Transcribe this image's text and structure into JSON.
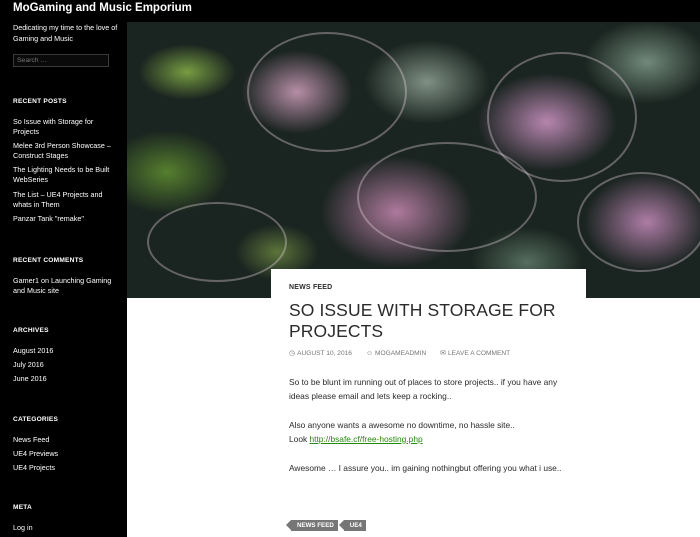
{
  "site": {
    "title": "MoGaming and Music Emporium",
    "description": "Dedicating my time to the love of Gaming and Music"
  },
  "search": {
    "placeholder": "Search …"
  },
  "widgets": {
    "recent_posts": {
      "title": "RECENT POSTS",
      "items": [
        "So Issue with Storage for Projects",
        "Melee 3rd Person Showcase – Construct Stages",
        "The Lighting Needs to be Built WebSeries",
        "The List – UE4 Projects and whats in Them",
        "Panzar Tank \"remake\""
      ]
    },
    "recent_comments": {
      "title": "RECENT COMMENTS",
      "author": "Gamer1",
      "on": " on ",
      "post": "Launching Gaming and Music site"
    },
    "archives": {
      "title": "ARCHIVES",
      "items": [
        "August 2016",
        "July 2016",
        "June 2016"
      ]
    },
    "categories": {
      "title": "CATEGORIES",
      "items": [
        "News Feed",
        "UE4 Previews",
        "UE4 Projects"
      ]
    },
    "meta": {
      "title": "META",
      "items": [
        "Log in"
      ]
    }
  },
  "post": {
    "category": "NEWS FEED",
    "title": "SO ISSUE WITH STORAGE FOR PROJECTS",
    "date": "AUGUST 10, 2016",
    "author": "MOGAMEADMIN",
    "comments": "LEAVE A COMMENT",
    "icons": {
      "date": "clock-icon",
      "author": "user-icon",
      "comments": "comment-icon"
    },
    "paragraph1": "So to be blunt im running out of places to store projects.. if you have any ideas please email and lets keep a rocking..",
    "paragraph2_line1": "Also anyone wants a awesome no downtime, no hassle site..",
    "paragraph2_prefix": "Look ",
    "paragraph2_link": "http://bsafe.cf/free-hosting.php",
    "paragraph3": "Awesome … I assure you.. im gaining nothingbut offering you what i use..",
    "tags": [
      "NEWS FEED",
      "UE4"
    ]
  },
  "colors": {
    "background": "#000000",
    "content": "#ffffff",
    "link": "#24890d",
    "tag": "#767676"
  }
}
